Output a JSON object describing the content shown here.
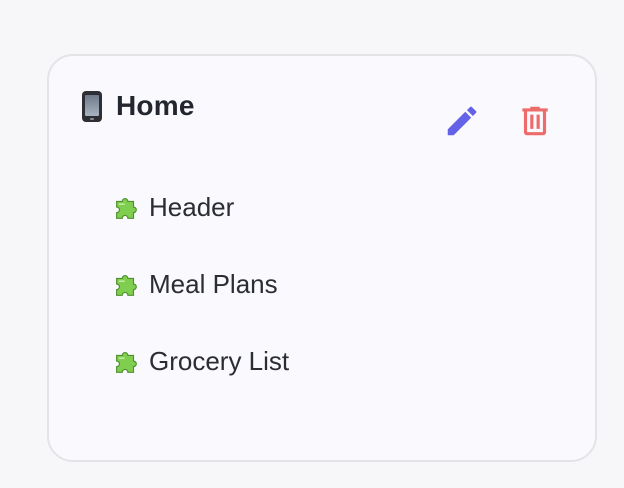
{
  "card": {
    "title": "Home",
    "title_icon": "mobile-phone-icon",
    "edit_icon": "pencil-icon",
    "delete_icon": "trash-icon",
    "colors": {
      "edit": "#6462e6",
      "delete": "#ee6b6b",
      "title_text": "#23262e",
      "item_text": "#2a2d34",
      "card_bg": "#faf9fd",
      "card_border": "#e3e3e8"
    },
    "items": [
      {
        "label": "Header",
        "icon": "puzzle-piece-icon"
      },
      {
        "label": "Meal Plans",
        "icon": "puzzle-piece-icon"
      },
      {
        "label": "Grocery List",
        "icon": "puzzle-piece-icon"
      }
    ]
  }
}
